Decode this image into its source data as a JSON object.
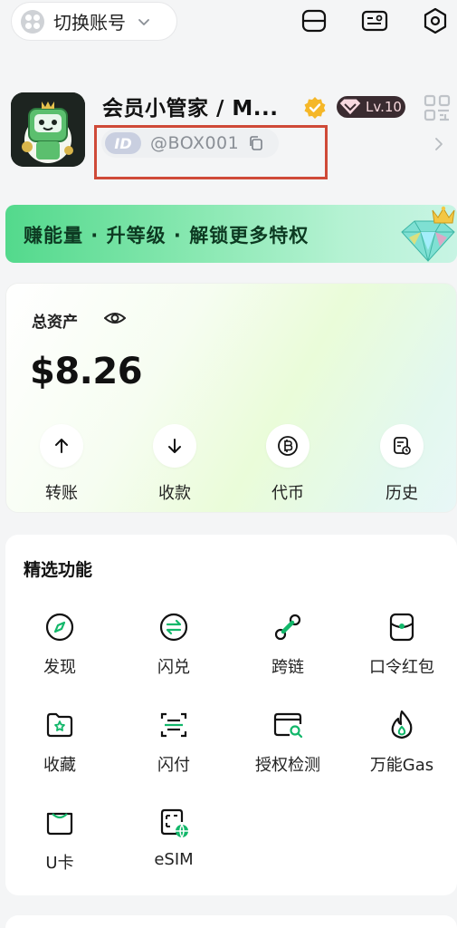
{
  "topbar": {
    "switch_account_label": "切换账号",
    "icons": [
      "grid-icon",
      "chevron-down-icon",
      "scan-icon",
      "id-card-icon",
      "settings-hex-icon"
    ]
  },
  "profile": {
    "name": "会员小管家 / M...",
    "level": "Lv.10",
    "id_tag": "ID",
    "handle": "@BOX001"
  },
  "banner": {
    "text": "赚能量 · 升等级 · 解锁更多特权"
  },
  "assets": {
    "title": "总资产",
    "balance": "$8.26",
    "actions": [
      {
        "label": "转账",
        "icon": "arrow-up-icon"
      },
      {
        "label": "收款",
        "icon": "arrow-down-icon"
      },
      {
        "label": "代币",
        "icon": "bitcoin-icon"
      },
      {
        "label": "历史",
        "icon": "history-icon"
      }
    ]
  },
  "features": {
    "title": "精选功能",
    "items": [
      {
        "label": "发现",
        "icon": "compass-icon"
      },
      {
        "label": "闪兑",
        "icon": "swap-icon"
      },
      {
        "label": "跨链",
        "icon": "cross-chain-icon"
      },
      {
        "label": "口令红包",
        "icon": "red-packet-icon"
      },
      {
        "label": "收藏",
        "icon": "folder-star-icon"
      },
      {
        "label": "闪付",
        "icon": "flash-pay-icon"
      },
      {
        "label": "授权检测",
        "icon": "auth-check-icon"
      },
      {
        "label": "万能Gas",
        "icon": "gas-flame-icon"
      },
      {
        "label": "U卡",
        "icon": "u-card-icon"
      },
      {
        "label": "eSIM",
        "icon": "esim-icon"
      }
    ]
  },
  "colors": {
    "accent_green": "#12b76a",
    "highlight_red": "#cf4a38",
    "badge_bg": "#3a2b30",
    "verify_gold": "#f5b728"
  }
}
